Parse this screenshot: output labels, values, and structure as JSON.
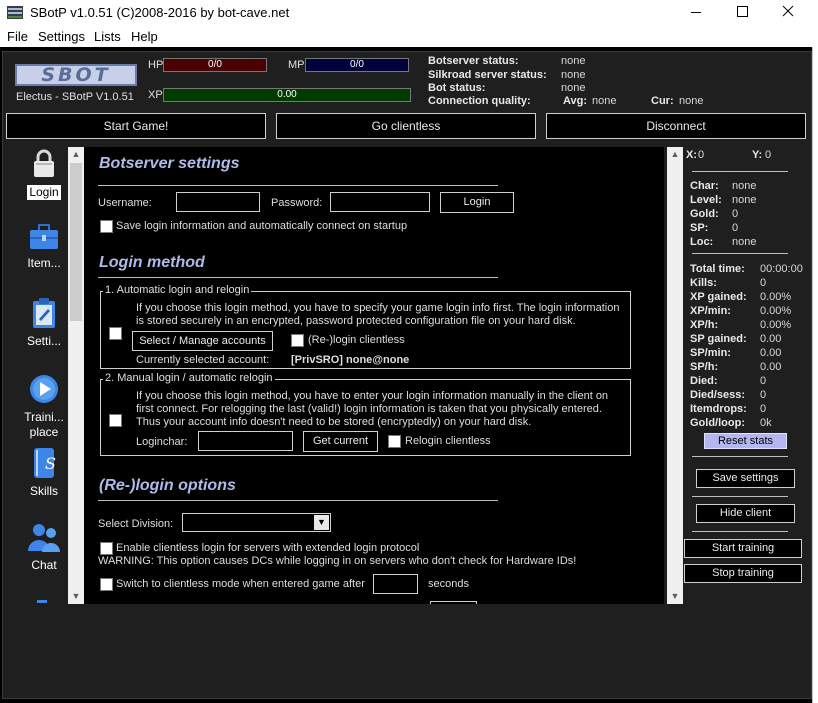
{
  "window": {
    "title": "SBotP v1.0.51 (C)2008-2016 by bot-cave.net",
    "minimize_glyph": "—",
    "maximize_glyph": "☐",
    "close_glyph": "✕"
  },
  "menu": [
    "File",
    "Settings",
    "Lists",
    "Help"
  ],
  "header": {
    "logo_text": "SBOT",
    "subtitle": "Electus - SBotP V1.0.51",
    "hp_label": "HP",
    "hp_value": "0/0",
    "mp_label": "MP",
    "mp_value": "0/0",
    "xp_label": "XP",
    "xp_value": "0.00",
    "status": {
      "botserver_label": "Botserver status:",
      "botserver_value": "none",
      "silkroad_label": "Silkroad server status:",
      "silkroad_value": "none",
      "bot_label": "Bot status:",
      "bot_value": "none",
      "connection_label": "Connection quality:",
      "avg_label": "Avg:",
      "avg_value": "none",
      "cur_label": "Cur:",
      "cur_value": "none"
    }
  },
  "top_buttons": {
    "start_game": "Start Game!",
    "go_clientless": "Go clientless",
    "disconnect": "Disconnect"
  },
  "nav": [
    {
      "label": "Login",
      "icon": "lock-icon"
    },
    {
      "label": "Item...",
      "icon": "briefcase-icon"
    },
    {
      "label": "Setti...",
      "icon": "clipboard-icon"
    },
    {
      "label": "Traini... place",
      "icon": "play-icon"
    },
    {
      "label": "Skills",
      "icon": "skills-book-icon"
    },
    {
      "label": "Chat",
      "icon": "chat-people-icon"
    }
  ],
  "botserver": {
    "heading": "Botserver settings",
    "username_label": "Username:",
    "username_value": "",
    "password_label": "Password:",
    "password_value": "",
    "login_button": "Login",
    "save_login_label": "Save login information and automatically connect on startup"
  },
  "login_method": {
    "heading": "Login method",
    "auto": {
      "title": "1. Automatic login and relogin",
      "desc1": "If you choose this login method, you have to specify your game login info first. The login information",
      "desc2": "is stored securely in an encrypted, password protected configuration file on your hard disk.",
      "select_button": "Select / Manage accounts",
      "relogin_clientless": "(Re-)login clientless",
      "current_label": "Currently selected account:",
      "current_value": "[PrivSRO] none@none"
    },
    "manual": {
      "title": "2. Manual login / automatic relogin",
      "desc1": "If you choose this login method, you have to enter your login information manually in the client on",
      "desc2": "first connect. For relogging the last (valid!) login information is taken that you physically entered.",
      "desc3": "Thus your account info doesn't need to be stored (encryptedly) on your hard disk.",
      "loginchar_label": "Loginchar:",
      "loginchar_value": "",
      "get_current": "Get current",
      "relogin_clientless": "Relogin clientless"
    }
  },
  "relogin_options": {
    "heading": "(Re-)login options",
    "division_label": "Select Division:",
    "division_value": "",
    "enable_clientless": "Enable clientless login for servers with extended login protocol",
    "warning": "WARNING: This option causes DCs while logging in on servers who don't check for Hardware IDs!",
    "switch_clientless": "Switch to clientless mode when entered game after",
    "seconds_value": "",
    "seconds_label": "seconds"
  },
  "stats": {
    "x_label": "X:",
    "x_value": "0",
    "y_label": "Y:",
    "y_value": "0",
    "char": [
      {
        "label": "Char:",
        "value": "none"
      },
      {
        "label": "Level:",
        "value": "none"
      },
      {
        "label": "Gold:",
        "value": "0"
      },
      {
        "label": "SP:",
        "value": "0"
      },
      {
        "label": "Loc:",
        "value": "none"
      }
    ],
    "training": [
      {
        "label": "Total time:",
        "value": "00:00:00"
      },
      {
        "label": "Kills:",
        "value": "0"
      },
      {
        "label": "XP gained:",
        "value": "0.00%"
      },
      {
        "label": "XP/min:",
        "value": "0.00%"
      },
      {
        "label": "XP/h:",
        "value": "0.00%"
      },
      {
        "label": "SP gained:",
        "value": "0.00"
      },
      {
        "label": "SP/min:",
        "value": "0.00"
      },
      {
        "label": "SP/h:",
        "value": "0.00"
      },
      {
        "label": "Died:",
        "value": "0"
      },
      {
        "label": "Died/sess:",
        "value": "0"
      },
      {
        "label": "Itemdrops:",
        "value": "0"
      },
      {
        "label": "Gold/loop:",
        "value": "0k"
      }
    ],
    "reset_button": "Reset stats"
  },
  "right_buttons": {
    "save_settings": "Save settings",
    "hide_client": "Hide client",
    "start_training": "Start training",
    "stop_training": "Stop training"
  },
  "colors": {
    "heading": "#aebbe8",
    "hp_bar": "#4a0000",
    "mp_bar": "#00003c",
    "xp_bar": "#003c00",
    "reset_button": "#b4b6f0"
  }
}
